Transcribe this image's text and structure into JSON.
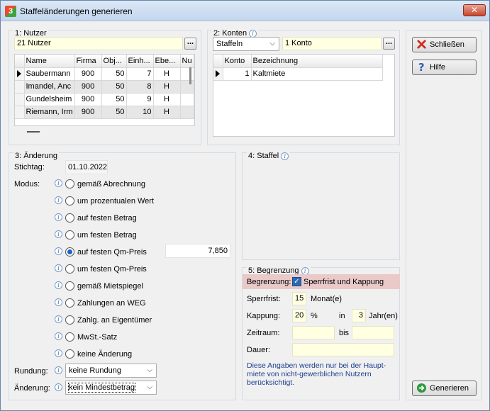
{
  "window": {
    "title": "Staffeländerungen generieren",
    "close_glyph": "✕"
  },
  "nutzer": {
    "label": "1: Nutzer",
    "field": "21 Nutzer",
    "dots": "...",
    "columns": [
      "Name",
      "Firma",
      "Obj...",
      "Einh...",
      "Ebe...",
      "Nu"
    ],
    "rows": [
      [
        "Saubermann",
        "900",
        "50",
        "7",
        "H"
      ],
      [
        "Imandel, Anc",
        "900",
        "50",
        "8",
        "H"
      ],
      [
        "Gundelsheim",
        "900",
        "50",
        "9",
        "H"
      ],
      [
        "Riemann, Irm",
        "900",
        "50",
        "10",
        "H"
      ]
    ]
  },
  "konten": {
    "label": "2: Konten",
    "combo": "Staffeln",
    "field": "1 Konto",
    "dots": "...",
    "columns": [
      "Konto",
      "Bezeichnung"
    ],
    "rows": [
      [
        "1",
        "Kaltmiete"
      ]
    ]
  },
  "aenderung": {
    "label": "3: Änderung",
    "stichtag_label": "Stichtag:",
    "stichtag_value": "01.10.2022",
    "modus_label": "Modus:",
    "modus_options": [
      "gemäß Abrechnung",
      "um prozentualen Wert",
      "auf festen Betrag",
      "um festen Betrag",
      "auf festen Qm-Preis",
      "um festen Qm-Preis",
      "gemäß Mietspiegel",
      "Zahlungen an WEG",
      "Zahlg. an Eigentümer",
      "MwSt.-Satz",
      "keine Änderung"
    ],
    "selected_index": 4,
    "qm_value": "7,850",
    "rundung_label": "Rundung:",
    "rundung_value": "keine Rundung",
    "aenderung_label": "Änderung:",
    "aenderung_value": "kein Mindestbetrag"
  },
  "staffel": {
    "label": "4: Staffel"
  },
  "begrenzung": {
    "label": "5: Begrenzung",
    "row_label": "Begrenzung:",
    "checkbox_label": "Sperrfrist und Kappung",
    "check_glyph": "✓",
    "sperrfrist_label": "Sperrfrist:",
    "sperrfrist_value": "15",
    "sperrfrist_unit": "Monat(e)",
    "kappung_label": "Kappung:",
    "kappung_value": "20",
    "kappung_unit": "%",
    "in_label": "in",
    "jahre_value": "3",
    "jahre_unit": "Jahr(en)",
    "zeitraum_label": "Zeitraum:",
    "bis_label": "bis",
    "dauer_label": "Dauer:",
    "note_line1": "Diese Angaben werden nur bei der Haupt-",
    "note_line2": "miete von nicht-gewerblichen Nutzern",
    "note_line3": "berücksichtigt."
  },
  "buttons": {
    "schliessen": "Schließen",
    "hilfe": "Hilfe",
    "generieren": "Generieren"
  },
  "info_glyph": "i"
}
